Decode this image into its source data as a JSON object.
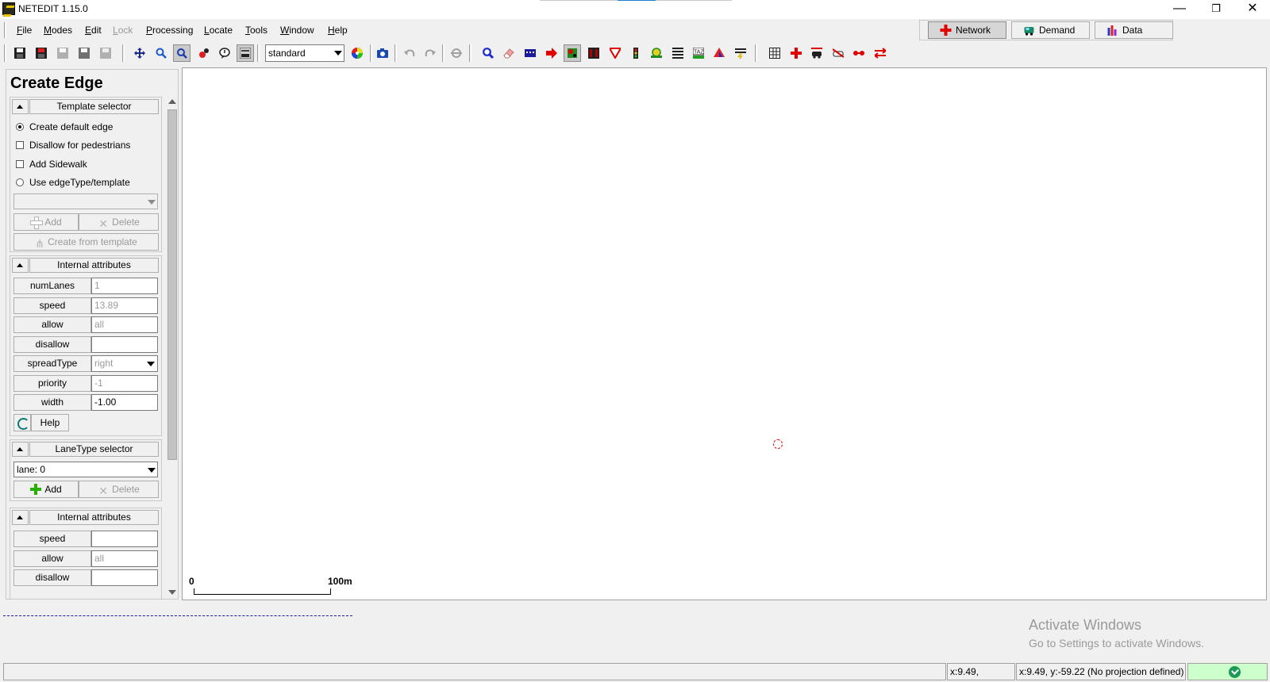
{
  "window": {
    "title": "NETEDIT 1.15.0",
    "minimize": "—",
    "restore": "❐",
    "close": "✕"
  },
  "menu": {
    "items": [
      "File",
      "Modes",
      "Edit",
      "Lock",
      "Processing",
      "Locate",
      "Tools",
      "Window",
      "Help"
    ]
  },
  "modes": {
    "network": "Network",
    "demand": "Demand",
    "data": "Data"
  },
  "toolbar": {
    "scheme_value": "standard"
  },
  "panel": {
    "title": "Create Edge",
    "template_selector": {
      "caption": "Template selector",
      "create_default": "Create default edge",
      "disallow_pedestrians": "Disallow for pedestrians",
      "add_sidewalk": "Add Sidewalk",
      "use_template": "Use edgeType/template",
      "add": "Add",
      "delete": "Delete",
      "create_from_template": "Create from template"
    },
    "internal_attributes": {
      "caption": "Internal attributes",
      "rows": [
        {
          "label": "numLanes",
          "value": "1"
        },
        {
          "label": "speed",
          "value": "13.89"
        },
        {
          "label": "allow",
          "value": "all"
        },
        {
          "label": "disallow",
          "value": ""
        },
        {
          "label": "spreadType",
          "value": "right"
        },
        {
          "label": "priority",
          "value": "-1"
        },
        {
          "label": "width",
          "value": "-1.00"
        }
      ],
      "help": "Help"
    },
    "lane_type_selector": {
      "caption": "LaneType selector",
      "selected": "lane: 0",
      "add": "Add",
      "delete": "Delete"
    },
    "lane_internal_attributes": {
      "caption": "Internal attributes",
      "rows": [
        {
          "label": "speed",
          "value": ""
        },
        {
          "label": "allow",
          "value": "all"
        },
        {
          "label": "disallow",
          "value": ""
        }
      ]
    }
  },
  "canvas": {
    "scale_start": "0",
    "scale_end": "100m"
  },
  "watermark": {
    "line1": "Activate Windows",
    "line2": "Go to Settings to activate Windows."
  },
  "status": {
    "coords": "x:9.49, y:-59.22",
    "geo": "x:9.49, y:-59.22 (No projection defined)"
  },
  "colors": {
    "network_icon": "#e00000",
    "ok_green": "#1a9a56",
    "marker_red": "#e00000"
  }
}
